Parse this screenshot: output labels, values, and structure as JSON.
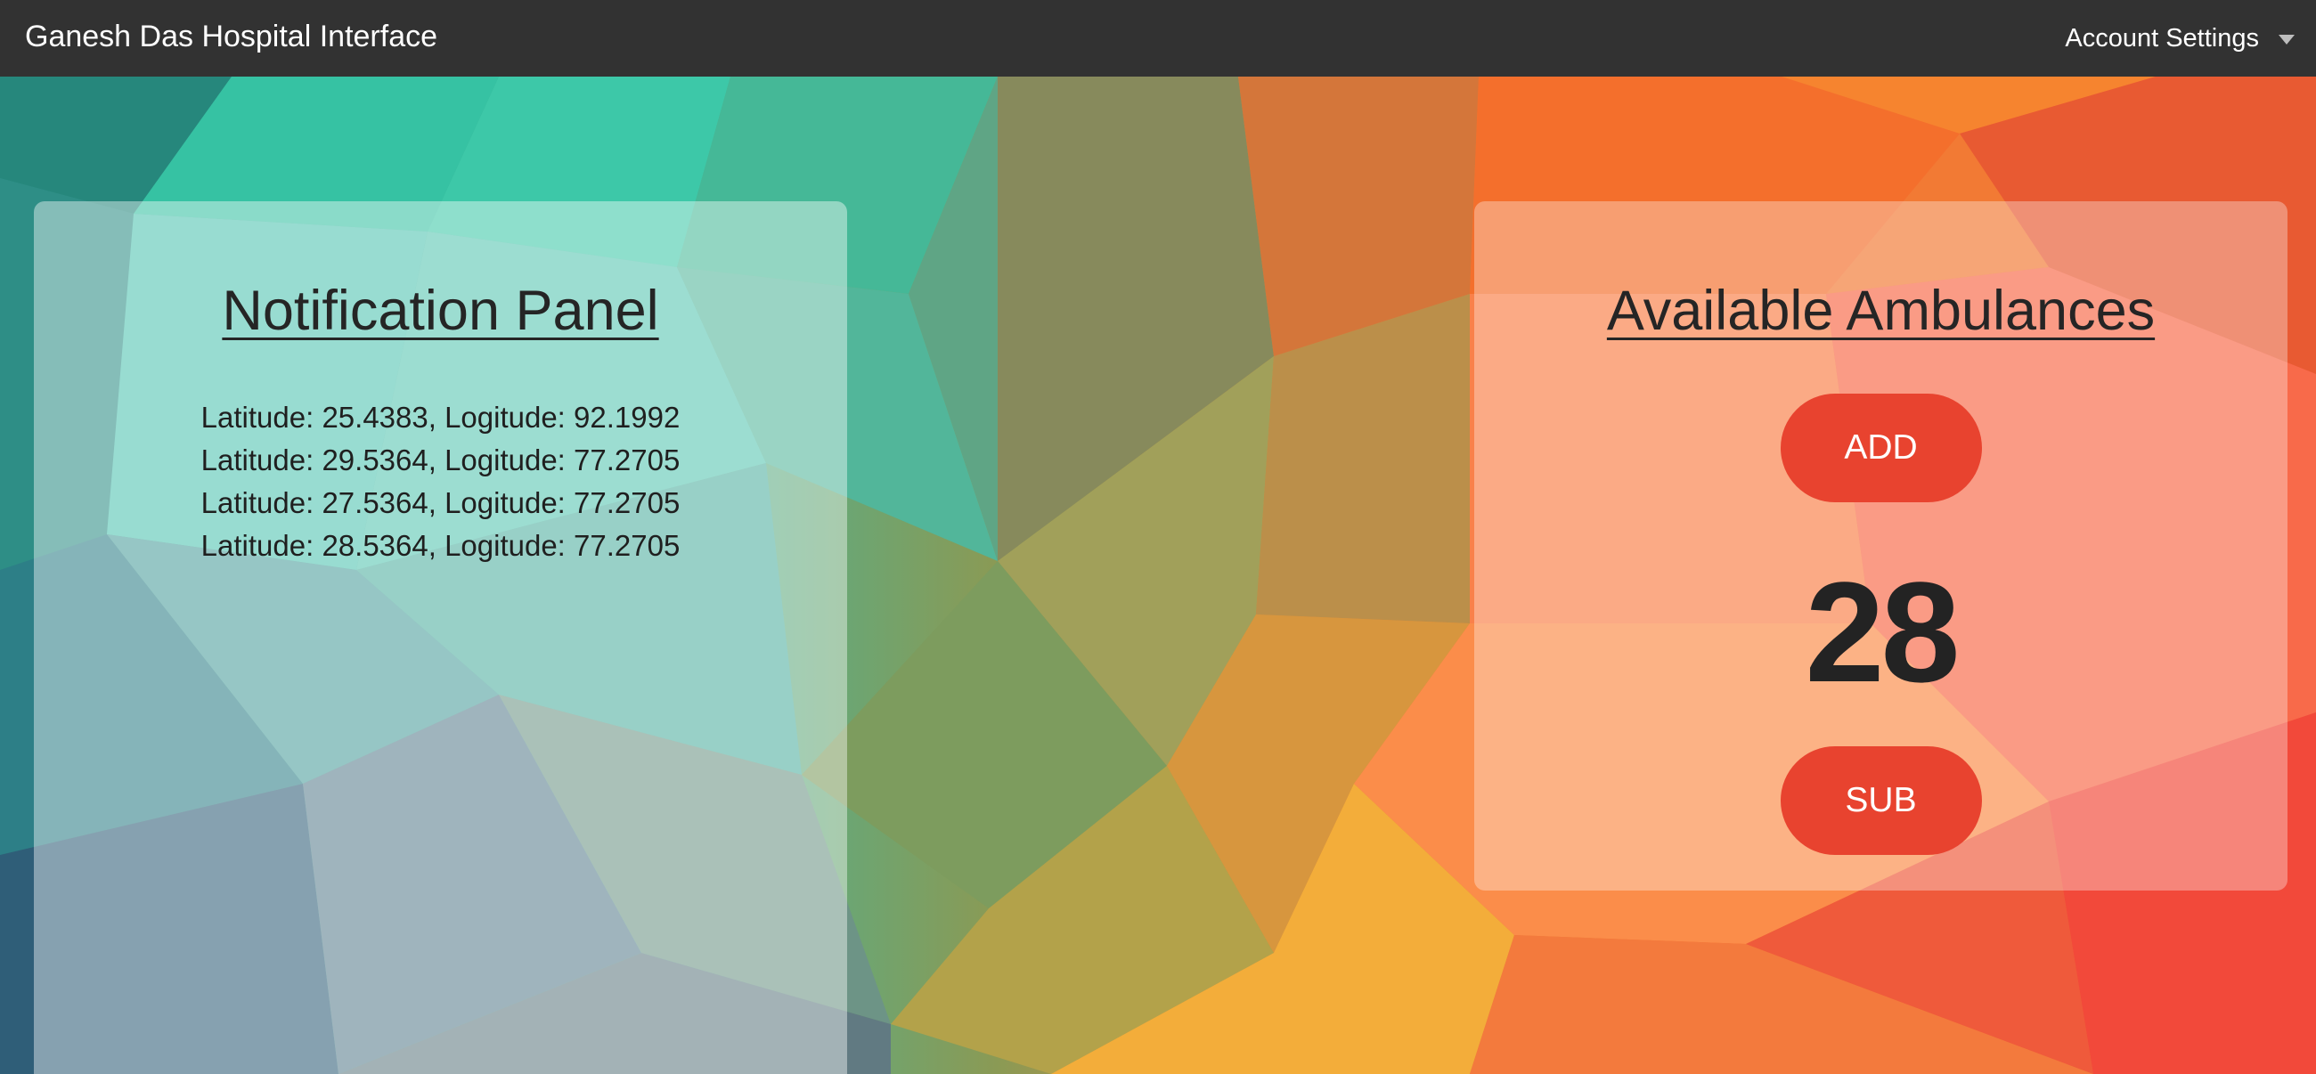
{
  "navbar": {
    "brand": "Ganesh Das Hospital Interface",
    "account_label": "Account Settings",
    "account_icon": "chevron-down-icon",
    "background": "#323232"
  },
  "notification_panel": {
    "title": "Notification Panel",
    "items": [
      "Latitude: 25.4383, Logitude: 92.1992",
      "Latitude: 29.5364, Logitude: 77.2705",
      "Latitude: 27.5364, Logitude: 77.2705",
      "Latitude: 28.5364, Logitude: 77.2705"
    ]
  },
  "ambulance_panel": {
    "title": "Available Ambulances",
    "add_label": "ADD",
    "count": "28",
    "sub_label": "SUB",
    "button_color": "#e8432f"
  }
}
